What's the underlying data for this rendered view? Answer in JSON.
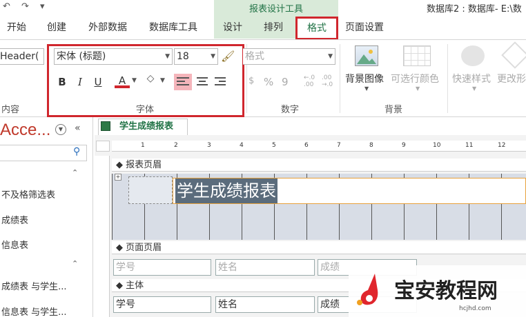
{
  "titlebar": {
    "window_title": "数据库2 : 数据库- E:\\数",
    "context_group": "报表设计工具"
  },
  "tabs": [
    {
      "label": "开始"
    },
    {
      "label": "创建"
    },
    {
      "label": "外部数据"
    },
    {
      "label": "数据库工具"
    },
    {
      "label": "设计"
    },
    {
      "label": "排列"
    },
    {
      "label": "格式"
    },
    {
      "label": "页面设置"
    }
  ],
  "ribbon": {
    "object_selector": "Header(",
    "group_selection_label": "内容",
    "font_name": "宋体 (标题)",
    "font_size": "18",
    "group_font_label": "字体",
    "number_format": "格式",
    "group_number_label": "数字",
    "background_image": "背景图像",
    "alt_row_color": "可选行颜色",
    "group_background_label": "背景",
    "quick_styles": "快速样式",
    "change_shape": "更改形",
    "bold": "B",
    "italic": "I",
    "underline": "U",
    "font_color": "A",
    "percent": "%",
    "comma": "9"
  },
  "nav": {
    "title": "Acce...",
    "items": [
      "不及格筛选表",
      "成绩表",
      "信息表",
      "成绩表 与学生...",
      "信息表 与学生..."
    ]
  },
  "document": {
    "tab_title": "学生成绩报表",
    "ruler_marks": [
      "1",
      "2",
      "3",
      "4",
      "5",
      "6",
      "7",
      "8",
      "9",
      "10",
      "11",
      "12"
    ],
    "sections": {
      "report_header": "报表页眉",
      "page_header": "页面页眉",
      "detail": "主体"
    },
    "title_control": "学生成绩报表",
    "page_header_fields": [
      "学号",
      "姓名",
      "成绩"
    ],
    "detail_fields": [
      "学号",
      "姓名",
      "成绩"
    ]
  },
  "watermark": {
    "text": "宝安教程网",
    "url": "hcjhd.com"
  },
  "colors": {
    "accent_green": "#217346",
    "highlight_red": "#d0262d",
    "context_bg": "#d9ead9"
  }
}
